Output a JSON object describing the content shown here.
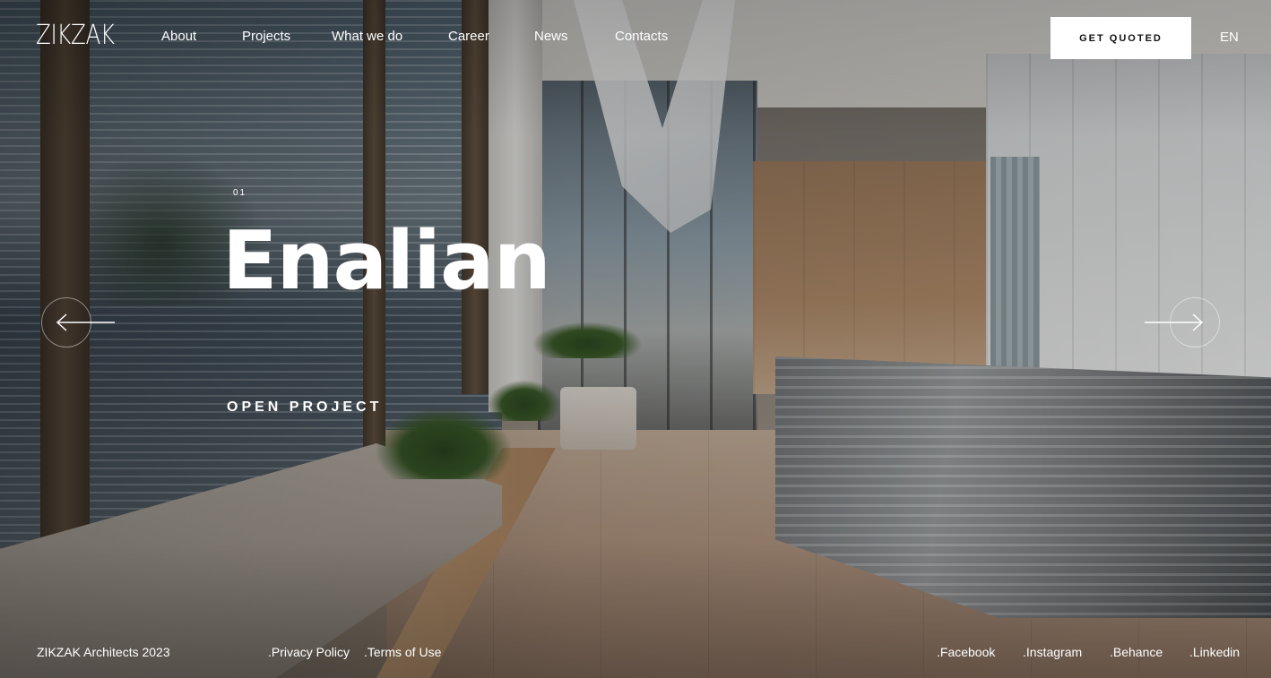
{
  "brand": {
    "logo": "ZIKZAK"
  },
  "nav": {
    "about": "About",
    "projects": "Projects",
    "what_we_do": "What we do",
    "career": "Career",
    "news": "News",
    "contacts": "Contacts"
  },
  "header": {
    "quote_label": "GET QUOTED",
    "language": "EN"
  },
  "hero": {
    "slide_number": "01",
    "title": "Enalian",
    "cta": "OPEN PROJECT"
  },
  "footer": {
    "copyright": "ZIKZAK Architects 2023",
    "privacy": ".Privacy Policy",
    "terms": ".Terms of Use",
    "facebook": ".Facebook",
    "instagram": ".Instagram",
    "behance": ".Behance",
    "linkedin": ".Linkedin"
  },
  "icons": {
    "prev": "arrow-left-icon",
    "next": "arrow-right-icon"
  },
  "colors": {
    "text": "#ffffff",
    "button_bg": "#ffffff",
    "button_text": "#111111"
  }
}
